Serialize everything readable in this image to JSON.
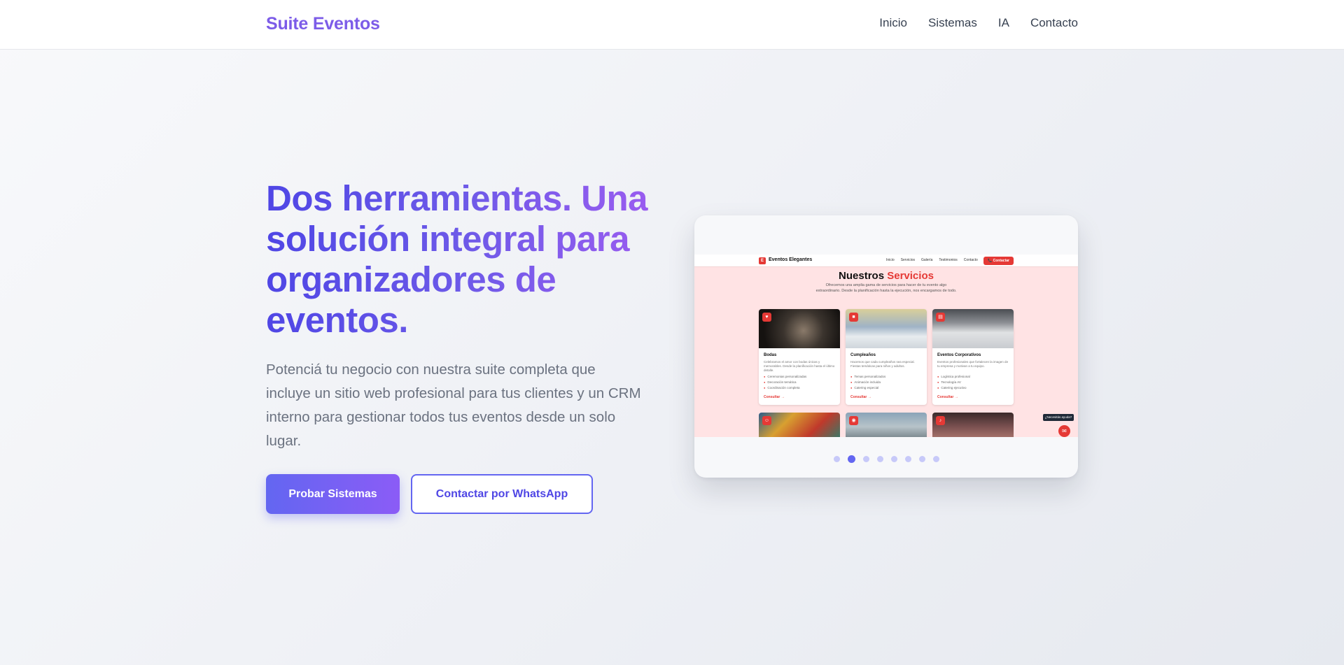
{
  "header": {
    "brand": "Suite Eventos",
    "nav": [
      "Inicio",
      "Sistemas",
      "IA",
      "Contacto"
    ]
  },
  "hero": {
    "title": "Dos herramientas. Una solución integral para organizadores de eventos.",
    "subtitle": "Potenciá tu negocio con nuestra suite completa que incluye un sitio web profesional para tus clientes y un CRM interno para gestionar todos tus eventos desde un solo lugar.",
    "primary_button": "Probar Sistemas",
    "secondary_button": "Contactar por WhatsApp"
  },
  "preview": {
    "logo_letter": "E",
    "brand": "Eventos Elegantes",
    "nav": [
      "Inicio",
      "Servicios",
      "Galería",
      "Testimonios",
      "Contacto"
    ],
    "cta": "📞 Contactar",
    "title_plain": "Nuestros",
    "title_accent": "Servicios",
    "description": "Ofrecemos una amplia gama de servicios para hacer de tu evento algo extraordinario. Desde la planificación hasta la ejecución, nos encargamos de todo.",
    "cards": [
      {
        "title": "Bodas",
        "text": "Celebramos el amor con bodas únicas y memorables. Desde la planificación hasta el último detalle.",
        "bullets": [
          "Ceremonias personalizadas",
          "Decoración temática",
          "Coordinación completa"
        ],
        "link": "Consultar →"
      },
      {
        "title": "Cumpleaños",
        "text": "Hacemos que cada cumpleaños sea especial. Fiestas temáticas para niños y adultos.",
        "bullets": [
          "Temas personalizados",
          "Animación incluida",
          "Catering especial"
        ],
        "link": "Consultar →"
      },
      {
        "title": "Eventos Corporativos",
        "text": "Eventos profesionales que fortalecen la imagen de tu empresa y motivan a tu equipo.",
        "bullets": [
          "Logística profesional",
          "Tecnología AV",
          "Catering ejecutivo"
        ],
        "link": "Consultar →"
      }
    ],
    "help_chip": "¿Necesitás ayuda?",
    "carousel_total": 8,
    "carousel_active": 2
  },
  "colors": {
    "brand": "#7c5ce8",
    "accent_indigo": "#6366f1",
    "accent_violet": "#8b5cf6",
    "preview_red": "#e53935"
  },
  "icons": {
    "card_1": "heart-icon",
    "card_2": "gift-icon",
    "card_3": "building-icon",
    "chat": "chat-icon"
  }
}
